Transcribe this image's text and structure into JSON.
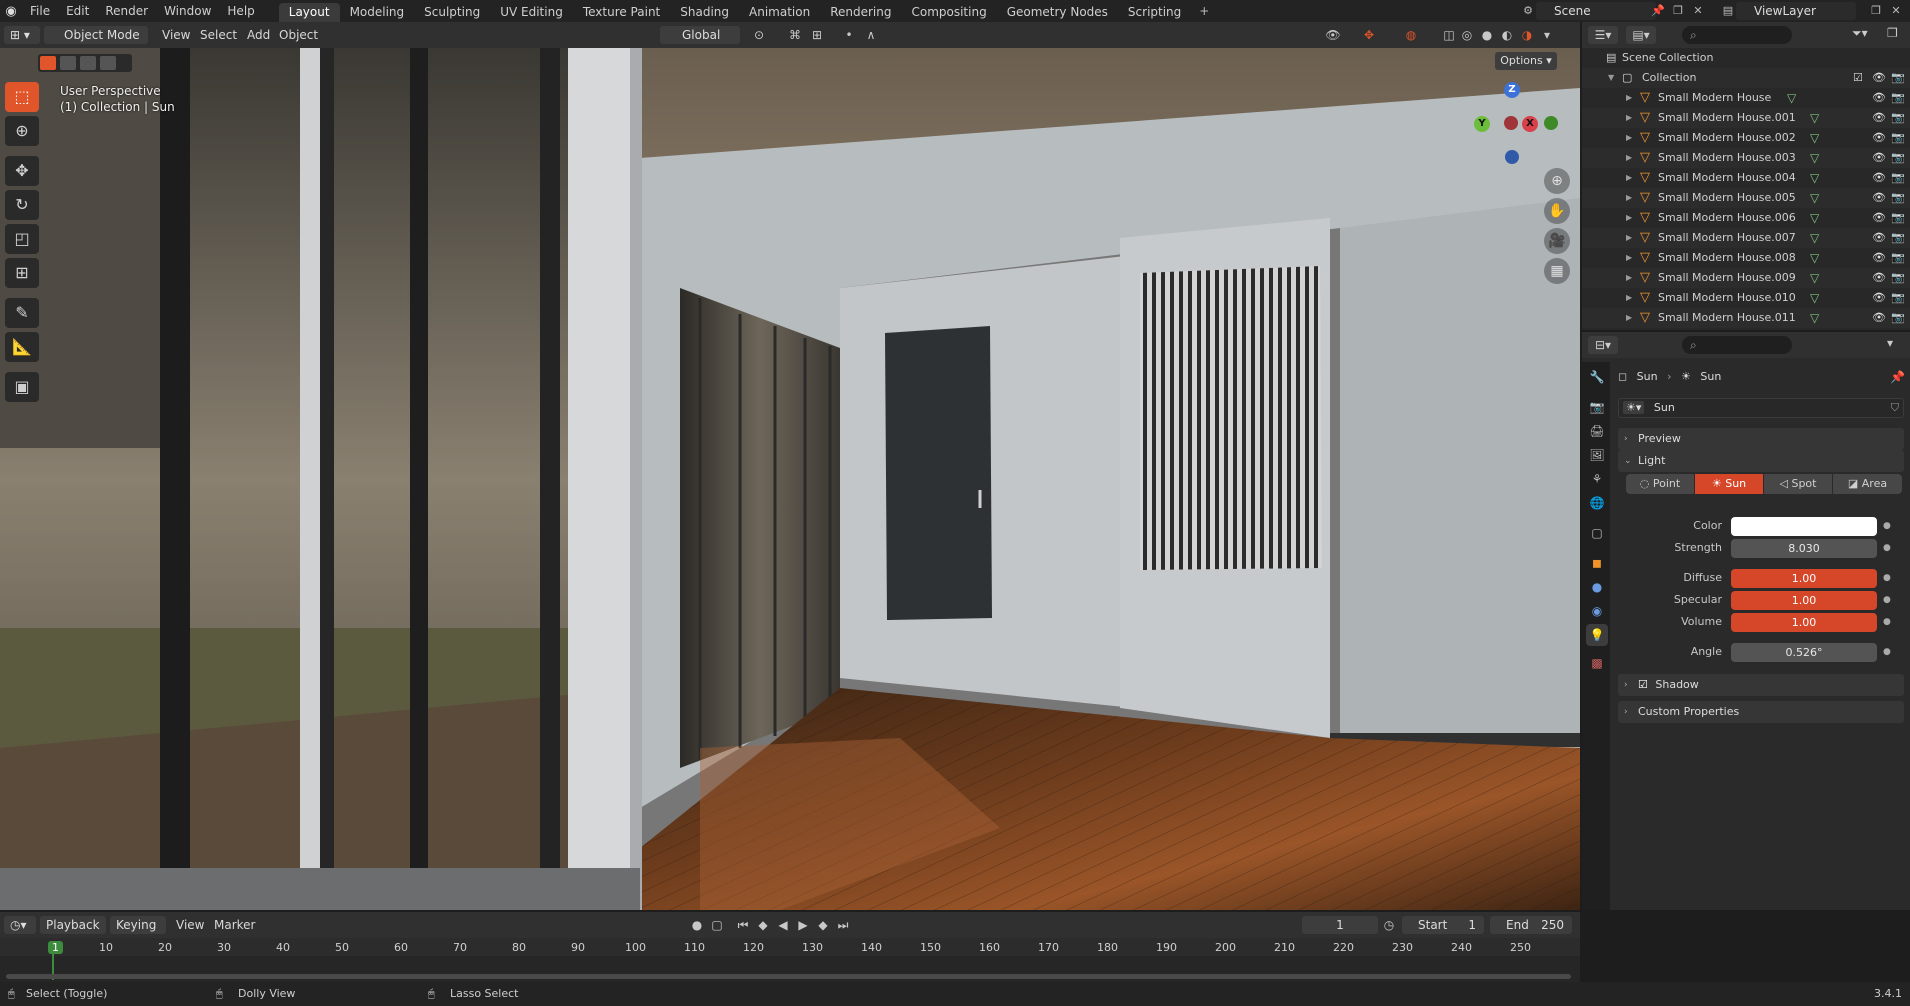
{
  "menu": [
    "File",
    "Edit",
    "Render",
    "Window",
    "Help"
  ],
  "workspaces": [
    "Layout",
    "Modeling",
    "Sculpting",
    "UV Editing",
    "Texture Paint",
    "Shading",
    "Animation",
    "Rendering",
    "Compositing",
    "Geometry Nodes",
    "Scripting"
  ],
  "active_workspace": "Layout",
  "scene": "Scene",
  "view_layer": "ViewLayer",
  "viewport": {
    "mode": "Object Mode",
    "menus": [
      "View",
      "Select",
      "Add",
      "Object"
    ],
    "transform_orientation": "Global",
    "options_label": "Options",
    "overlay_line1": "User Perspective",
    "overlay_line2": "(1) Collection | Sun",
    "gizmo": {
      "z": "Z",
      "y": "Y",
      "x": "X"
    }
  },
  "outliner": {
    "root": "Scene Collection",
    "collection": "Collection",
    "items": [
      "Small Modern House",
      "Small Modern House.001",
      "Small Modern House.002",
      "Small Modern House.003",
      "Small Modern House.004",
      "Small Modern House.005",
      "Small Modern House.006",
      "Small Modern House.007",
      "Small Modern House.008",
      "Small Modern House.009",
      "Small Modern House.010",
      "Small Modern House.011"
    ]
  },
  "properties": {
    "breadcrumb_object": "Sun",
    "breadcrumb_data": "Sun",
    "datablock": "Sun",
    "panels": {
      "preview": "Preview",
      "light": "Light",
      "shadow": "Shadow",
      "custom": "Custom Properties"
    },
    "light_types": [
      "Point",
      "Sun",
      "Spot",
      "Area"
    ],
    "active_light_type": "Sun",
    "fields": {
      "color_label": "Color",
      "strength_label": "Strength",
      "strength": "8.030",
      "diffuse_label": "Diffuse",
      "diffuse": "1.00",
      "specular_label": "Specular",
      "specular": "1.00",
      "volume_label": "Volume",
      "volume": "1.00",
      "angle_label": "Angle",
      "angle": "0.526°"
    },
    "color_value": "#ffffff"
  },
  "timeline": {
    "menus": [
      "Playback",
      "Keying",
      "View",
      "Marker"
    ],
    "current_frame": "1",
    "start_label": "Start",
    "start": "1",
    "end_label": "End",
    "end": "250",
    "ticks": [
      "1",
      "10",
      "20",
      "30",
      "40",
      "50",
      "60",
      "70",
      "80",
      "90",
      "100",
      "110",
      "120",
      "130",
      "140",
      "150",
      "160",
      "170",
      "180",
      "190",
      "200",
      "210",
      "220",
      "230",
      "240",
      "250"
    ]
  },
  "statusbar": {
    "left": "Select (Toggle)",
    "middle": "Dolly View",
    "right": "Lasso Select",
    "version": "3.4.1"
  },
  "colors": {
    "accent": "#e0552a",
    "active_field": "#d6472a",
    "object_icon": "#f0932b",
    "mesh_icon": "#7ec27e"
  }
}
